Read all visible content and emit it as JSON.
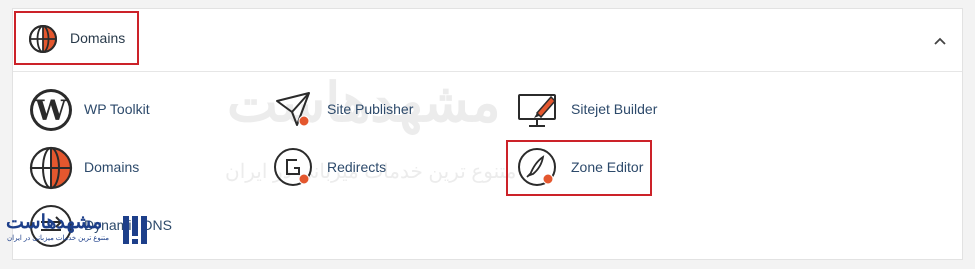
{
  "header": {
    "title": "Domains"
  },
  "tools": [
    {
      "label": "WP Toolkit",
      "icon": "wordpress-icon"
    },
    {
      "label": "Site Publisher",
      "icon": "paper-plane-icon"
    },
    {
      "label": "Sitejet Builder",
      "icon": "monitor-brush-icon"
    },
    {
      "label": "Domains",
      "icon": "globe-icon"
    },
    {
      "label": "Redirects",
      "icon": "redirect-icon"
    },
    {
      "label": "Zone Editor",
      "icon": "zone-editor-icon"
    },
    {
      "label": "Dynamic DNS",
      "icon": "dynamic-dns-icon"
    }
  ],
  "watermark": {
    "text": "مشهدهاست",
    "subtitle": "متنوع ترین خدمات میزبانی در ایران"
  },
  "colors": {
    "accent": "#e4572e",
    "highlight": "#cc2229",
    "link": "#2d4a6b",
    "brand": "#1d3f8a"
  }
}
